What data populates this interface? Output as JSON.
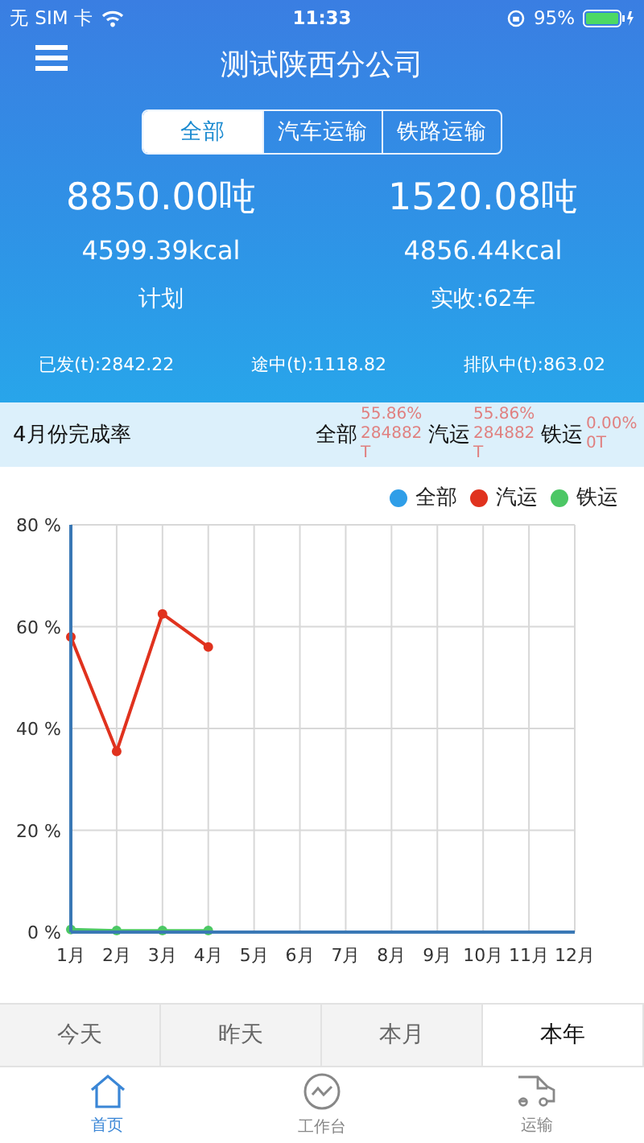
{
  "status_bar": {
    "carrier": "无 SIM 卡",
    "time": "11:33",
    "battery": "95%"
  },
  "header": {
    "title": "测试陕西分公司"
  },
  "segments": [
    {
      "label": "全部",
      "selected": true
    },
    {
      "label": "汽车运输",
      "selected": false
    },
    {
      "label": "铁路运输",
      "selected": false
    }
  ],
  "summary": [
    {
      "tons": "8850.00吨",
      "kcal": "4599.39kcal",
      "caption": "计划"
    },
    {
      "tons": "1520.08吨",
      "kcal": "4856.44kcal",
      "caption": "实收:62车"
    }
  ],
  "stats": [
    "已发(t):2842.22",
    "途中(t):1118.82",
    "排队中(t):863.02"
  ],
  "completion": {
    "title": "4月份完成率",
    "items": [
      {
        "label": "全部",
        "lines": [
          "55.86%",
          "284882",
          "T"
        ]
      },
      {
        "label": "汽运",
        "lines": [
          "55.86%",
          "284882",
          "T"
        ]
      },
      {
        "label": "铁运",
        "lines": [
          "0.00%",
          "0T"
        ]
      }
    ]
  },
  "chart": {
    "chart_data": {
      "type": "line",
      "grid": true,
      "categories": [
        "1月",
        "2月",
        "3月",
        "4月",
        "5月",
        "6月",
        "7月",
        "8月",
        "9月",
        "10月",
        "11月",
        "12月"
      ],
      "series": [
        {
          "name": "全部",
          "color": "#2f9ee8",
          "values": [
            null,
            null,
            null,
            null,
            null,
            null,
            null,
            null,
            null,
            null,
            null,
            null
          ]
        },
        {
          "name": "汽运",
          "color": "#e0321e",
          "marker": "circle",
          "values": [
            58,
            35.5,
            62.5,
            56,
            null,
            null,
            null,
            null,
            null,
            null,
            null,
            null
          ]
        },
        {
          "name": "铁运",
          "color": "#4cc765",
          "marker": "circle",
          "values": [
            0.5,
            0.3,
            0.3,
            0.3,
            null,
            null,
            null,
            null,
            null,
            null,
            null,
            null
          ]
        }
      ],
      "ylim": [
        0,
        80
      ],
      "yticks": [
        {
          "value": 0,
          "label": "0 %"
        },
        {
          "value": 20,
          "label": "20 %"
        },
        {
          "value": 40,
          "label": "40 %"
        },
        {
          "value": 60,
          "label": "60 %"
        },
        {
          "value": 80,
          "label": "80 %"
        }
      ]
    }
  },
  "periods": [
    {
      "label": "今天",
      "selected": false
    },
    {
      "label": "昨天",
      "selected": false
    },
    {
      "label": "本月",
      "selected": false
    },
    {
      "label": "本年",
      "selected": true
    }
  ],
  "nav": [
    {
      "label": "首页",
      "kind": "home",
      "selected": true
    },
    {
      "label": "工作台",
      "kind": "chart",
      "selected": false
    },
    {
      "label": "运输",
      "kind": "truck",
      "selected": false
    }
  ]
}
